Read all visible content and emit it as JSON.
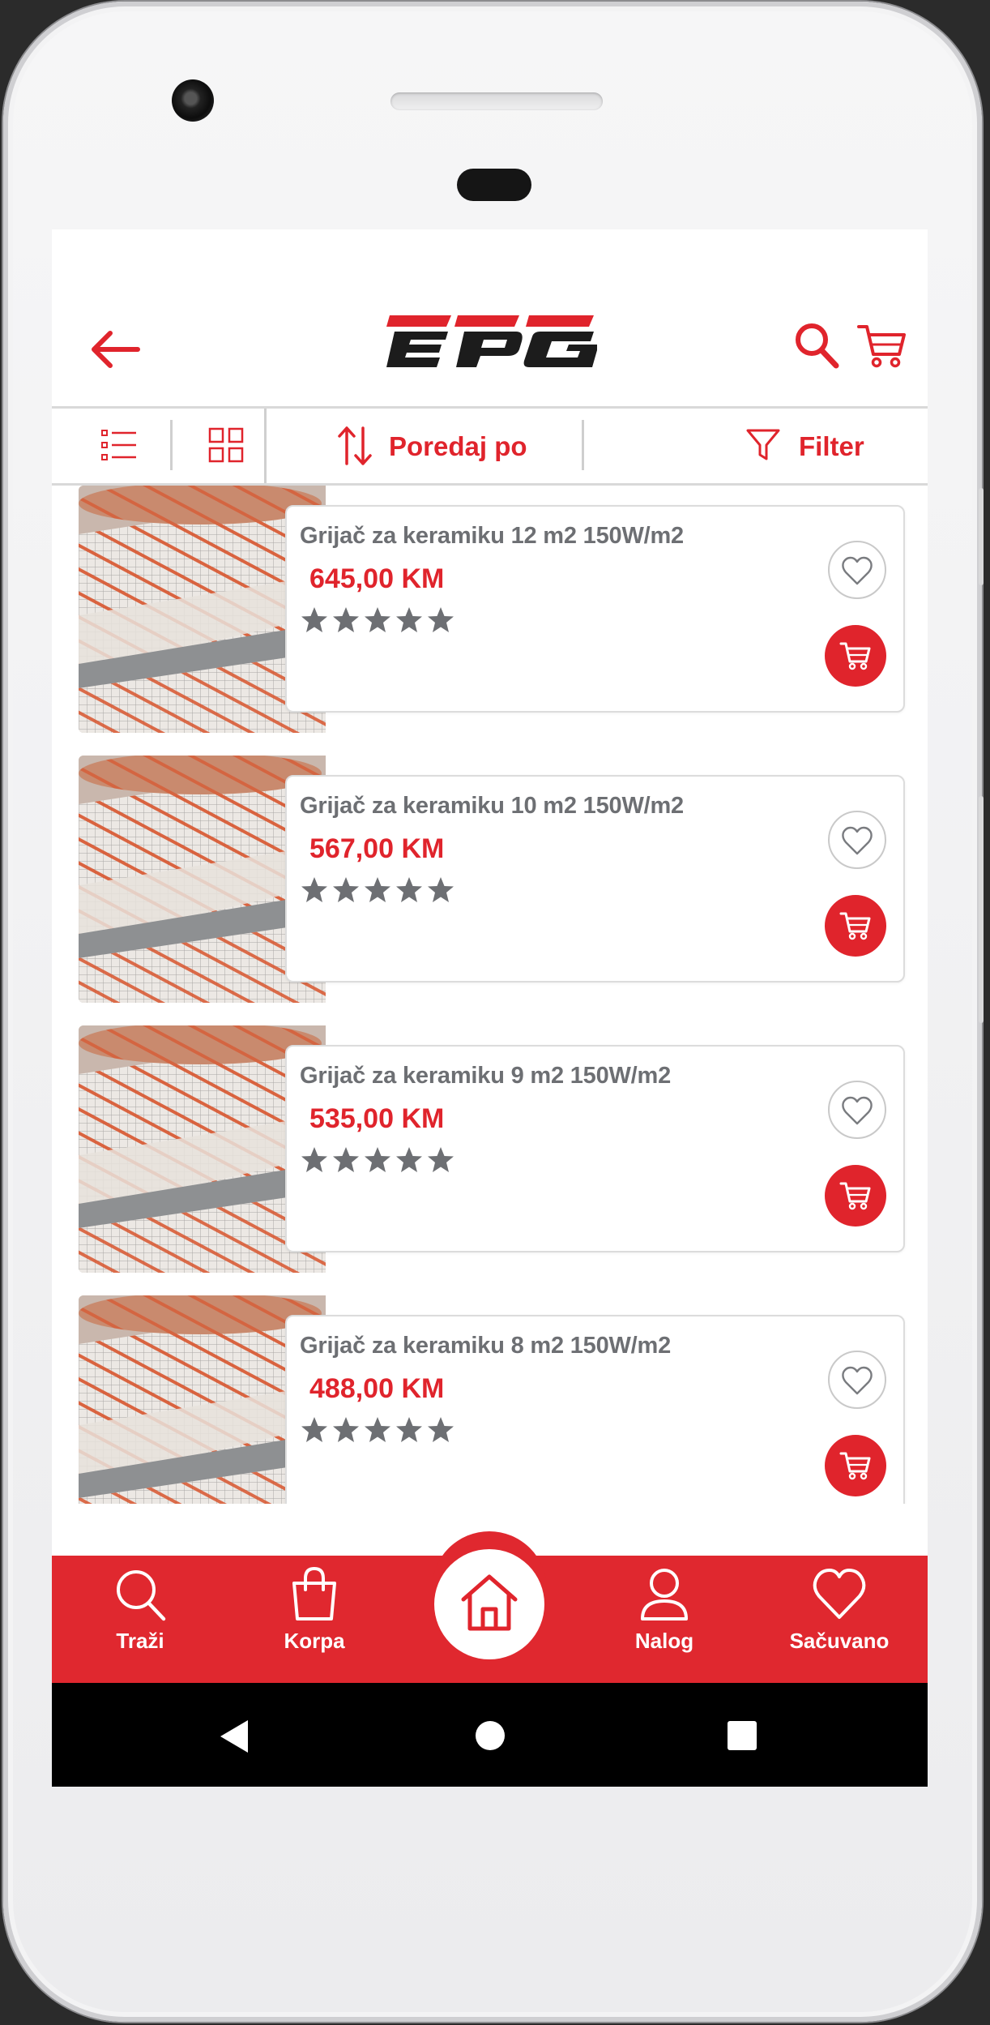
{
  "app": {
    "brand": "EPG",
    "accent_color": "#e0242c",
    "text_gray": "#6d6f73"
  },
  "header": {
    "back_icon": "arrow-left-icon",
    "search_icon": "search-icon",
    "cart_icon": "cart-icon"
  },
  "toolbar": {
    "list_view_icon": "list-view-icon",
    "grid_view_icon": "grid-view-icon",
    "sort_label": "Poredaj po",
    "sort_icon": "sort-arrows-icon",
    "filter_label": "Filter",
    "filter_icon": "funnel-icon"
  },
  "products": [
    {
      "title": "Grijač za keramiku 12 m2 150W/m2",
      "price": "645,00 KM",
      "stars": 5
    },
    {
      "title": "Grijač za keramiku 10 m2 150W/m2",
      "price": "567,00 KM",
      "stars": 5
    },
    {
      "title": "Grijač za keramiku 9 m2 150W/m2",
      "price": "535,00 KM",
      "stars": 5
    },
    {
      "title": "Grijač za keramiku 8 m2 150W/m2",
      "price": "488,00 KM",
      "stars": 5
    }
  ],
  "bottom_nav": {
    "items": [
      {
        "label": "Traži",
        "icon": "search-icon"
      },
      {
        "label": "Korpa",
        "icon": "shopping-bag-icon"
      },
      {
        "label": "",
        "icon": "home-icon"
      },
      {
        "label": "Nalog",
        "icon": "user-icon"
      },
      {
        "label": "Sačuvano",
        "icon": "heart-icon"
      }
    ]
  },
  "android_nav": {
    "back_icon": "triangle-back-icon",
    "home_icon": "circle-home-icon",
    "recents_icon": "square-recents-icon"
  }
}
